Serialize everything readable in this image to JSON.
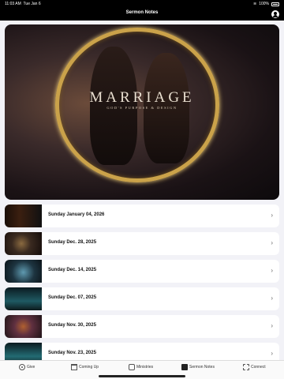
{
  "status_bar": {
    "time": "11:03 AM",
    "date": "Tue Jan 6",
    "battery": "100%"
  },
  "header": {
    "title": "Sermon Notes"
  },
  "hero": {
    "title": "MARRIAGE",
    "subtitle": "GOD'S PURPOSE & DESIGN"
  },
  "sermons": [
    {
      "label": "Sunday January 04, 2026"
    },
    {
      "label": "Sunday Dec. 28, 2025"
    },
    {
      "label": "Sunday Dec. 14, 2025"
    },
    {
      "label": "Sunday Dec. 07, 2025"
    },
    {
      "label": "Sunday Nov. 30, 2025"
    },
    {
      "label": "Sunday Nov. 23, 2025"
    },
    {
      "label": ""
    }
  ],
  "tabs": [
    {
      "label": "Give",
      "icon": "give-icon"
    },
    {
      "label": "Coming Up",
      "icon": "calendar-icon"
    },
    {
      "label": "Ministries",
      "icon": "ministries-icon"
    },
    {
      "label": "Sermon Notes",
      "icon": "notes-icon"
    },
    {
      "label": "Connect",
      "icon": "connect-icon"
    }
  ],
  "colors": {
    "accent_gold": "#caa24a",
    "background": "#f2f2f7"
  }
}
